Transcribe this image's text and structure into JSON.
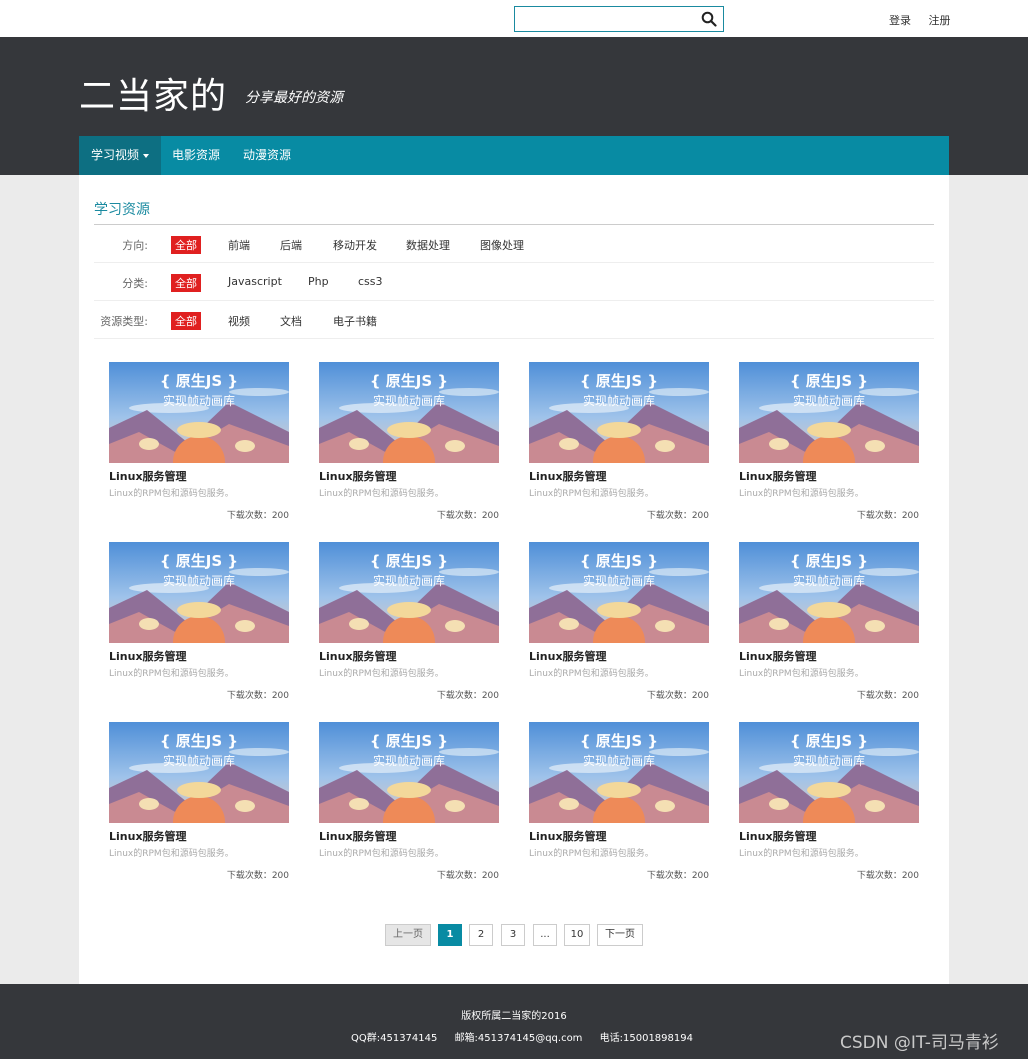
{
  "header": {
    "search_placeholder": "",
    "login": "登录",
    "register": "注册",
    "logo": "二当家的",
    "slogan": "分享最好的资源"
  },
  "nav": {
    "items": [
      {
        "label": "学习视频",
        "active": true
      },
      {
        "label": "电影资源"
      },
      {
        "label": "动漫资源"
      }
    ]
  },
  "main": {
    "section_title": "学习资源",
    "filters": [
      {
        "label": "方向:",
        "options": [
          "全部",
          "前端",
          "后端",
          "移动开发",
          "数据处理",
          "图像处理"
        ]
      },
      {
        "label": "分类:",
        "options": [
          "全部",
          "Javascript",
          "Php",
          "css3"
        ]
      },
      {
        "label": "资源类型:",
        "options": [
          "全部",
          "视频",
          "文档",
          "电子书籍"
        ]
      }
    ],
    "thumb_text": {
      "line1": "{ 原生JS }",
      "line2": "实现帧动画库"
    },
    "cards": [
      {
        "title": "Linux服务管理",
        "desc": "Linux的RPM包和源码包服务。",
        "downloads": "下载次数：200"
      },
      {
        "title": "Linux服务管理",
        "desc": "Linux的RPM包和源码包服务。",
        "downloads": "下载次数：200"
      },
      {
        "title": "Linux服务管理",
        "desc": "Linux的RPM包和源码包服务。",
        "downloads": "下载次数：200"
      },
      {
        "title": "Linux服务管理",
        "desc": "Linux的RPM包和源码包服务。",
        "downloads": "下载次数：200"
      },
      {
        "title": "Linux服务管理",
        "desc": "Linux的RPM包和源码包服务。",
        "downloads": "下载次数：200"
      },
      {
        "title": "Linux服务管理",
        "desc": "Linux的RPM包和源码包服务。",
        "downloads": "下载次数：200"
      },
      {
        "title": "Linux服务管理",
        "desc": "Linux的RPM包和源码包服务。",
        "downloads": "下载次数：200"
      },
      {
        "title": "Linux服务管理",
        "desc": "Linux的RPM包和源码包服务。",
        "downloads": "下载次数：200"
      },
      {
        "title": "Linux服务管理",
        "desc": "Linux的RPM包和源码包服务。",
        "downloads": "下载次数：200"
      },
      {
        "title": "Linux服务管理",
        "desc": "Linux的RPM包和源码包服务。",
        "downloads": "下载次数：200"
      },
      {
        "title": "Linux服务管理",
        "desc": "Linux的RPM包和源码包服务。",
        "downloads": "下载次数：200"
      },
      {
        "title": "Linux服务管理",
        "desc": "Linux的RPM包和源码包服务。",
        "downloads": "下载次数：200"
      }
    ],
    "pagination": {
      "prev": "上一页",
      "pages": [
        "1",
        "2",
        "3",
        "...",
        "10"
      ],
      "next": "下一页",
      "current": "1"
    }
  },
  "footer": {
    "copyright": "版权所属二当家的2016",
    "qq": "QQ群:451374145",
    "email": "邮箱:451374145@qq.com",
    "phone": "电话:15001898194",
    "watermark": "CSDN @IT-司马青衫"
  },
  "colors": {
    "accent": "#088ba3",
    "header_bg": "#35373b",
    "active_filter": "#e02020"
  }
}
